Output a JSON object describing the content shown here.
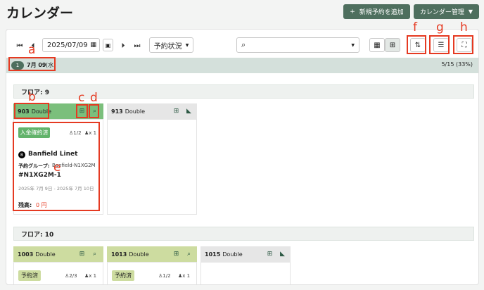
{
  "page": {
    "title": "カレンダー"
  },
  "header": {
    "new_booking_label": "新規予約を追加",
    "new_booking_icon": "plus-icon",
    "manage_label": "カレンダー管理",
    "manage_icon": "chevron-down-icon"
  },
  "toolbar": {
    "date_value": "2025/07/09",
    "status_label": "予約状況",
    "search_placeholder": ""
  },
  "date_row": {
    "count": "1",
    "date": "7月 09",
    "weekday": "(水)",
    "occupancy": "5/15 (33%)"
  },
  "annotations": [
    "a",
    "b",
    "c",
    "d",
    "e",
    "f",
    "g",
    "h"
  ],
  "floors": [
    {
      "label": "フロア: 9",
      "rooms": [
        {
          "number": "903",
          "type": "Double",
          "card": {
            "status": "入金確約済",
            "adults": "1/2",
            "guests": "x 1",
            "guest_name": "Banfield Linet",
            "group_label": "予約グループ:",
            "group_value": "Banfield-N1XG2M",
            "booking_id": "#N1XG2M-1",
            "dates": "2025年 7月 9日 - 2025年 7月 10日",
            "balance_label": "残高:",
            "balance_value": "0 円"
          }
        },
        {
          "number": "913",
          "type": "Double"
        }
      ]
    },
    {
      "label": "フロア: 10",
      "rooms": [
        {
          "number": "1003",
          "type": "Double",
          "card": {
            "status": "予約済",
            "adults": "2/3",
            "guests": "x 1"
          }
        },
        {
          "number": "1013",
          "type": "Double",
          "card": {
            "status": "予約済",
            "adults": "1/2",
            "guests": "x 1"
          }
        },
        {
          "number": "1015",
          "type": "Double"
        }
      ]
    }
  ],
  "colors": {
    "brand": "#4e6f5e",
    "booked_header": "#cddca0",
    "selected_header": "#7bbf7c",
    "paid_badge": "#62b36b",
    "annotation": "#e53a22",
    "balance": "#e53a22"
  }
}
